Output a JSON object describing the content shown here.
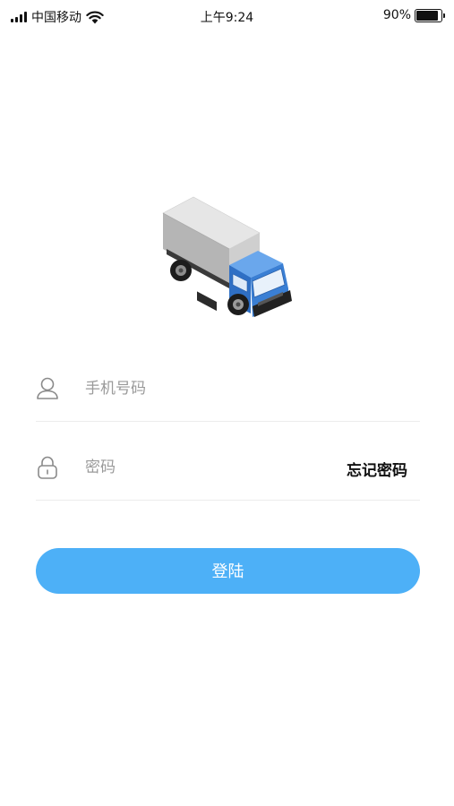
{
  "status_bar": {
    "carrier": "中国移动",
    "time": "上午9:24",
    "battery_percent": "90%",
    "battery_level": 0.9,
    "icons": [
      "signal-icon",
      "wifi-icon",
      "battery-icon"
    ]
  },
  "illustration": {
    "icon": "truck-illustration",
    "colors": {
      "cab": "#3a7fd4",
      "cargo_box": "#e6e6e6",
      "tires": "#1c1c1c"
    }
  },
  "login_form": {
    "phone": {
      "icon": "user-icon",
      "placeholder": "手机号码",
      "value": ""
    },
    "password": {
      "icon": "lock-icon",
      "placeholder": "密码",
      "value": ""
    },
    "forgot_password_label": "忘记密码",
    "login_label": "登陆"
  },
  "colors": {
    "accent": "#4db0f7",
    "divider": "#ececec",
    "placeholder": "#9a9a9a"
  }
}
